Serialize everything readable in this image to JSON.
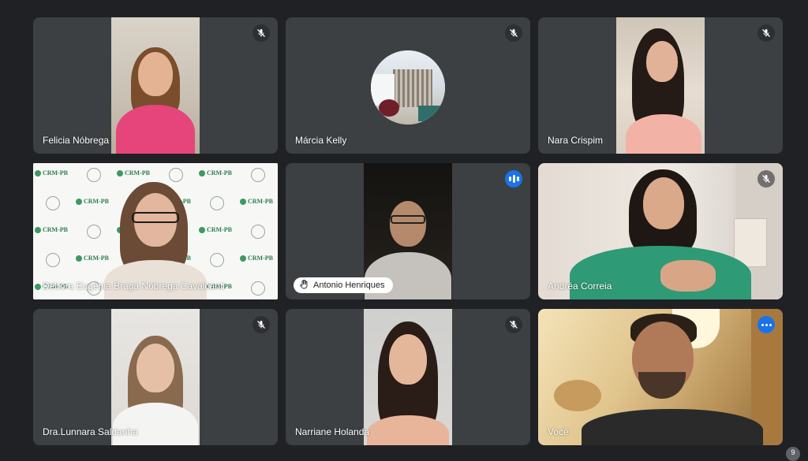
{
  "colors": {
    "background": "#202124",
    "tile": "#3c4043",
    "accent": "#1a73e8",
    "self_border": "#8ab4f8"
  },
  "tiles": [
    {
      "name": "Felicia Nóbrega",
      "status": "muted",
      "status_icon": "mic-off-icon"
    },
    {
      "name": "Márcia Kelly",
      "status": "muted",
      "status_icon": "mic-off-icon"
    },
    {
      "name": "Nara Crispim",
      "status": "muted",
      "status_icon": "mic-off-icon"
    },
    {
      "name": "Débora Eugênia Braga Nóbrega Cavalcanti",
      "status": "none",
      "background_text": "CRM-PB"
    },
    {
      "name": "Antonio Henriques",
      "status": "speaking",
      "status_icon": "audio-level-icon",
      "hand_icon": "raised-hand-icon"
    },
    {
      "name": "Andréa Correia",
      "status": "muted",
      "status_icon": "mic-off-icon"
    },
    {
      "name": "Dra.Lunnara Saldanha",
      "status": "muted",
      "status_icon": "mic-off-icon"
    },
    {
      "name": "Narriane Holanda",
      "status": "muted",
      "status_icon": "mic-off-icon"
    },
    {
      "name": "Você",
      "status": "self",
      "status_icon": "more-options-icon"
    }
  ],
  "participant_count": "9"
}
